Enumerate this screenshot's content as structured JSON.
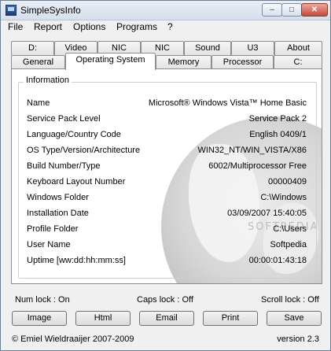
{
  "window": {
    "title": "SimpleSysInfo"
  },
  "titlebar": {
    "minimize": "–",
    "maximize": "□",
    "close": "✕"
  },
  "menu": [
    "File",
    "Report",
    "Options",
    "Programs",
    "?"
  ],
  "tabs_back": [
    "D:",
    "Video",
    "NIC",
    "NIC",
    "Sound",
    "U3",
    "About"
  ],
  "tabs_front": [
    "General",
    "Operating System",
    "Memory",
    "Processor",
    "C:"
  ],
  "active_tab": "Operating System",
  "info": {
    "group_label": "Information",
    "rows": [
      {
        "key": "Name",
        "value": "Microsoft® Windows Vista™ Home Basic"
      },
      {
        "key": "Service Pack Level",
        "value": "Service Pack 2"
      },
      {
        "key": "Language/Country Code",
        "value": "English 0409/1"
      },
      {
        "key": "OS Type/Version/Architecture",
        "value": "WIN32_NT/WIN_VISTA/X86"
      },
      {
        "key": "Build Number/Type",
        "value": "6002/Multiprocessor Free"
      },
      {
        "key": "Keyboard Layout Number",
        "value": "00000409"
      },
      {
        "key": "Windows Folder",
        "value": "C:\\Windows"
      },
      {
        "key": "Installation Date",
        "value": "03/09/2007 15:40:05"
      },
      {
        "key": "Profile Folder",
        "value": "C:\\Users"
      },
      {
        "key": "User Name",
        "value": "Softpedia"
      },
      {
        "key": "Uptime [ww:dd:hh:mm:ss]",
        "value": "00:00:01:43:18"
      }
    ]
  },
  "watermark": "SOFTPEDIA",
  "status": {
    "num_lock": "Num lock : On",
    "caps_lock": "Caps lock : Off",
    "scroll_lock": "Scroll lock : Off"
  },
  "buttons": {
    "image": "Image",
    "html": "Html",
    "email": "Email",
    "print": "Print",
    "save": "Save"
  },
  "footer": {
    "copyright": "© Emiel Wieldraaijer 2007-2009",
    "version": "version 2.3"
  },
  "icons": {
    "app": "app-window-icon",
    "globe": "globe-background-icon"
  }
}
